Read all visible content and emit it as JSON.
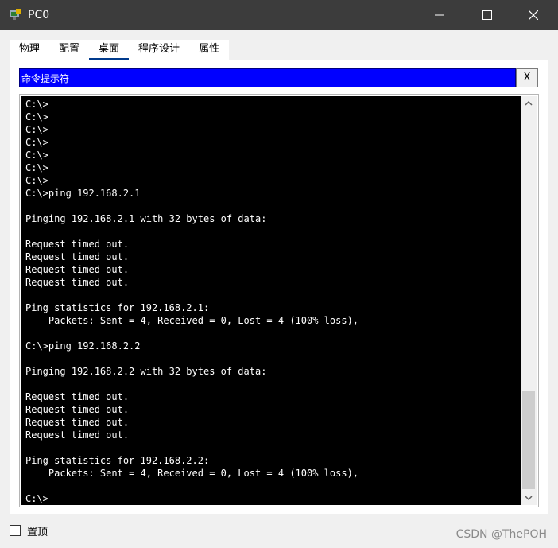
{
  "window": {
    "title": "PC0",
    "app_icon": "packet-tracer-pc-icon",
    "controls": [
      "minimize-icon",
      "maximize-icon",
      "close-icon"
    ]
  },
  "tabs": [
    {
      "label": "物理",
      "active": false
    },
    {
      "label": "配置",
      "active": false
    },
    {
      "label": "桌面",
      "active": true
    },
    {
      "label": "程序设计",
      "active": false
    },
    {
      "label": "属性",
      "active": false
    }
  ],
  "command_prompt": {
    "title": "命令提示符",
    "close_label": "X",
    "lines": [
      "C:\\>",
      "C:\\>",
      "C:\\>",
      "C:\\>",
      "C:\\>",
      "C:\\>",
      "C:\\>",
      "C:\\>",
      "C:\\>ping 192.168.2.1",
      "",
      "Pinging 192.168.2.1 with 32 bytes of data:",
      "",
      "Request timed out.",
      "Request timed out.",
      "Request timed out.",
      "Request timed out.",
      "",
      "Ping statistics for 192.168.2.1:",
      "    Packets: Sent = 4, Received = 0, Lost = 4 (100% loss),",
      "",
      "C:\\>ping 192.168.2.2",
      "",
      "Pinging 192.168.2.2 with 32 bytes of data:",
      "",
      "Request timed out.",
      "Request timed out.",
      "Request timed out.",
      "Request timed out.",
      "",
      "Ping statistics for 192.168.2.2:",
      "    Packets: Sent = 4, Received = 0, Lost = 4 (100% loss),",
      "",
      "C:\\>"
    ]
  },
  "footer": {
    "always_on_top_label": "置顶",
    "always_on_top_checked": false
  },
  "watermark": "CSDN @ThePOH",
  "colors": {
    "titlebar": "#3c3c3c",
    "header_blue": "#0000ff",
    "terminal_bg": "#000000",
    "terminal_fg": "#ffffff",
    "active_tab_underline": "#003a8c"
  }
}
